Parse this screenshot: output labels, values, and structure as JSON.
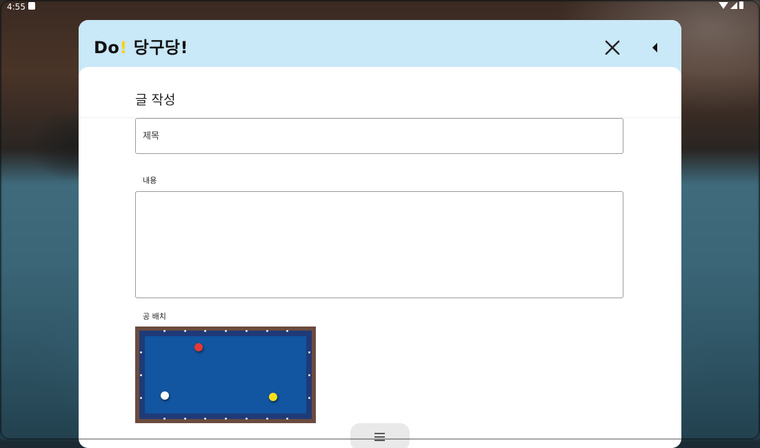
{
  "status_bar": {
    "time": "4:55"
  },
  "header": {
    "logo_do": "Do",
    "logo_bang": "!",
    "logo_name": "당구당!",
    "close_icon": "close-icon",
    "back_icon": "back-triangle-icon"
  },
  "form": {
    "heading": "글 작성",
    "title_placeholder": "제목",
    "title_value": "",
    "content_label": "내용",
    "content_value": "",
    "balls_label": "공 배치"
  },
  "balls": [
    {
      "name": "red",
      "color": "#e53935"
    },
    {
      "name": "white",
      "color": "#fafafa"
    },
    {
      "name": "yellow",
      "color": "#f4e11a"
    }
  ],
  "colors": {
    "appbar": "#c9e8f8",
    "accent_yellow": "#f5d21b",
    "table_frame": "#6b4b3e",
    "table_rail": "#1f3a78",
    "table_felt": "#1255a0"
  },
  "bottom_handle_icon": "menu-handle-icon"
}
